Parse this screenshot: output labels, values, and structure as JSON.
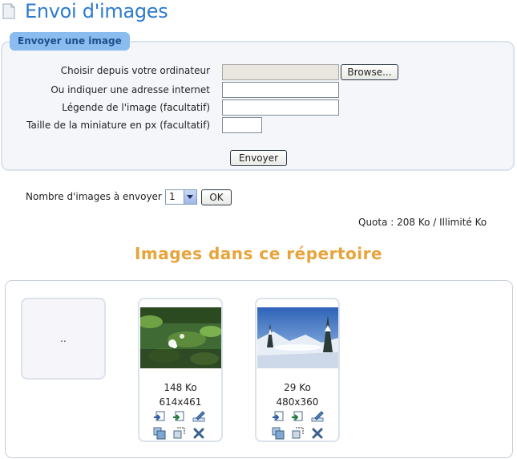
{
  "header": {
    "title": "Envoi d'images"
  },
  "upload_form": {
    "legend": "Envoyer une image",
    "file_label": "Choisir depuis votre ordinateur",
    "browse_label": "Browse...",
    "url_label": "Ou indiquer une adresse internet",
    "url_value": "",
    "caption_label": "Légende de l'image (facultatif)",
    "caption_value": "",
    "thumb_size_label": "Taille de la miniature en px (facultatif)",
    "thumb_size_value": "",
    "submit_label": "Envoyer"
  },
  "image_count": {
    "label": "Nombre d'images à envoyer :",
    "selected": "1",
    "ok_label": "OK"
  },
  "quota": {
    "text": "Quota : 208 Ko / Illimité Ko"
  },
  "directory": {
    "title": "Images dans ce répertoire",
    "parent_label": "..",
    "images": [
      {
        "size": "148 Ko",
        "dimensions": "614x461",
        "subject": "water lilies"
      },
      {
        "size": "29 Ko",
        "dimensions": "480x360",
        "subject": "snowy landscape"
      }
    ]
  },
  "icons": {
    "insert": "insert-icon",
    "insert_thumb": "insert-thumbnail-icon",
    "rename": "rename-icon",
    "copy": "copy-icon",
    "resize": "resize-icon",
    "delete": "delete-icon"
  },
  "colors": {
    "title": "#2e7bcf",
    "legend_bg": "#8bbcf0",
    "section_title": "#e8a33a"
  }
}
